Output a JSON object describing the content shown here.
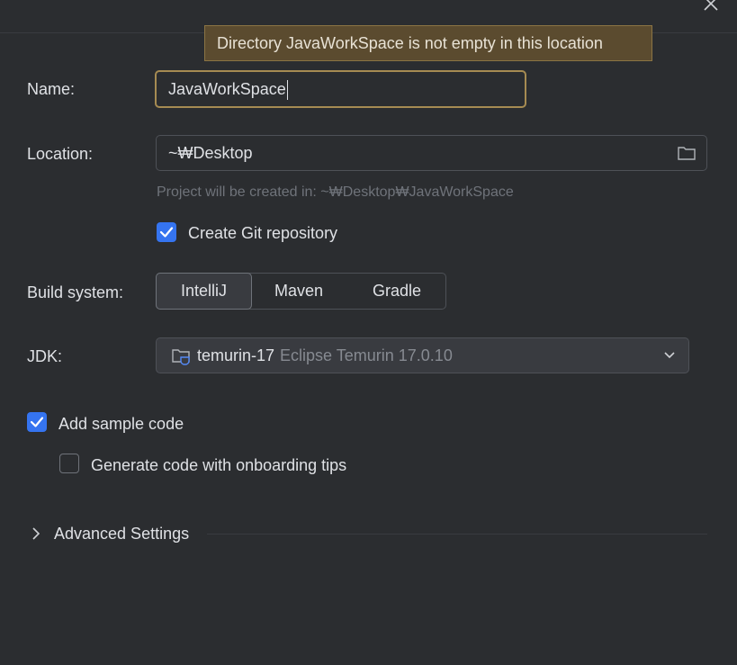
{
  "tooltip": {
    "text": "Directory JavaWorkSpace is not empty in this location"
  },
  "form": {
    "name_label": "Name:",
    "name_value": "JavaWorkSpace",
    "location_label": "Location:",
    "location_value": "~₩Desktop",
    "location_hint": "Project will be created in: ~₩Desktop₩JavaWorkSpace",
    "git_label": "Create Git repository",
    "git_checked": true,
    "build_label": "Build system:",
    "build_options": [
      "IntelliJ",
      "Maven",
      "Gradle"
    ],
    "build_selected": "IntelliJ",
    "jdk_label": "JDK:",
    "jdk_name": "temurin-17",
    "jdk_desc": "Eclipse Temurin 17.0.10",
    "sample_label": "Add sample code",
    "sample_checked": true,
    "onboarding_label": "Generate code with onboarding tips",
    "onboarding_checked": false,
    "advanced_label": "Advanced Settings"
  },
  "icons": {
    "close": "close-icon",
    "folder": "folder-icon",
    "jdk": "jdk-folder-icon",
    "dropdown": "chevron-down-icon",
    "expand": "chevron-right-icon",
    "check": "check-icon"
  },
  "colors": {
    "background": "#2b2d30",
    "accent": "#3574f0",
    "tooltip_bg": "#5b4b2f",
    "focus_border": "#a68b52"
  }
}
